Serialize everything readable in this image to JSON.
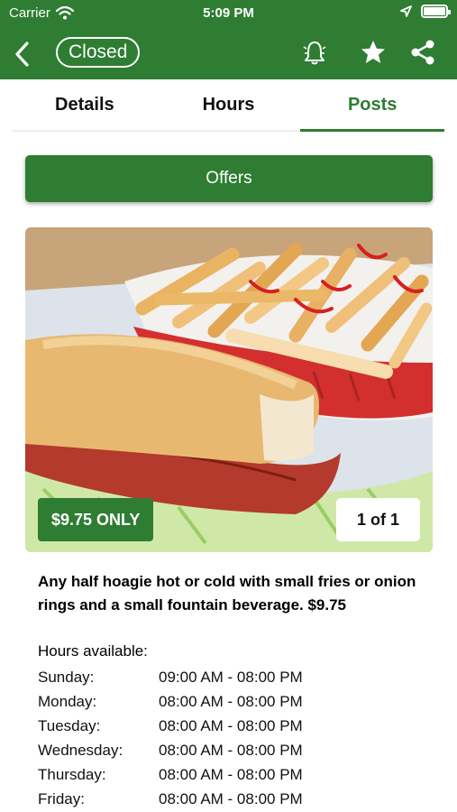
{
  "status_bar": {
    "carrier": "Carrier",
    "time": "5:09 PM"
  },
  "header": {
    "status_pill": "Closed",
    "icons": [
      "back-chevron-icon",
      "bell-icon",
      "star-icon",
      "share-icon"
    ]
  },
  "tabs": [
    {
      "label": "Details",
      "active": false
    },
    {
      "label": "Hours",
      "active": false
    },
    {
      "label": "Posts",
      "active": true
    }
  ],
  "offers_button": "Offers",
  "post": {
    "price_badge": "$9.75 ONLY",
    "image_counter": "1 of 1",
    "description": "Any half hoagie hot or cold with small fries or onion rings and a small fountain beverage. $9.75",
    "hours_title": "Hours available:",
    "hours": [
      {
        "day": "Sunday:",
        "time": "09:00 AM - 08:00 PM"
      },
      {
        "day": "Monday:",
        "time": "08:00 AM - 08:00 PM"
      },
      {
        "day": "Tuesday:",
        "time": "08:00 AM - 08:00 PM"
      },
      {
        "day": "Wednesday:",
        "time": "08:00 AM - 08:00 PM"
      },
      {
        "day": "Thursday:",
        "time": "08:00 AM - 08:00 PM"
      },
      {
        "day": "Friday:",
        "time": "08:00 AM - 08:00 PM"
      }
    ]
  },
  "colors": {
    "brand_green": "#2e7d32",
    "white": "#ffffff",
    "text": "#111111"
  }
}
